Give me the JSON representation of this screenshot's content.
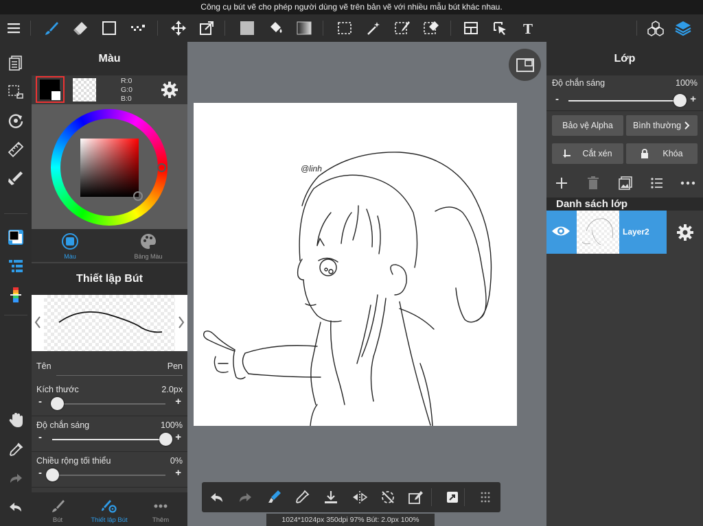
{
  "tooltip": "Công cụ bút vẽ cho phép người dùng vẽ trên bản vẽ với nhiều mẫu bút khác nhau.",
  "colors": {
    "accent": "#2f9ce8",
    "toolbar_bg": "#2d2d2d",
    "panel_bg": "#3a3a3a",
    "canvas_bg": "#6f7378",
    "layer_selected": "#3d9ae0",
    "primary_color": "#000000"
  },
  "toolbar": {
    "items": [
      "menu-icon",
      "brush-icon",
      "eraser-icon",
      "rectangle-icon",
      "dot-pen-icon",
      "move-icon",
      "transform-icon",
      "fill-color-icon",
      "bucket-icon",
      "gradient-icon",
      "select-rect-icon",
      "magic-wand-icon",
      "select-pen-icon",
      "select-eraser-icon",
      "layout-icon",
      "operation-icon",
      "text-icon",
      "materials-icon",
      "layers-icon"
    ]
  },
  "left_tools": [
    "layers-list-icon",
    "selection-icon",
    "rotate-icon",
    "ruler-icon",
    "pen-fill-icon",
    "color-swatch-icon",
    "layer-list-icon",
    "palette-strip-icon",
    "hand-icon",
    "eyedropper-icon",
    "redo-icon",
    "undo-icon"
  ],
  "color_panel": {
    "title": "Màu",
    "rgb": {
      "r": "R:0",
      "g": "G:0",
      "b": "B:0"
    },
    "tab_color": "Màu",
    "tab_palette": "Bảng Màu"
  },
  "pen_settings": {
    "title": "Thiết lập Bút",
    "name_label": "Tên",
    "name_value": "Pen",
    "size_label": "Kích thước",
    "size_value": "2.0px",
    "size_fraction": 0.04,
    "opacity_label": "Độ chắn sáng",
    "opacity_value": "100%",
    "opacity_fraction": 1.0,
    "min_width_label": "Chiều rộng tối thiểu",
    "min_width_value": "0%",
    "min_width_fraction": 0.0
  },
  "bottom_tabs": {
    "brush": "Bút",
    "settings": "Thiết lập Bút",
    "more": "Thêm"
  },
  "canvas": {
    "signature": "@linh",
    "status": "1024*1024px 350dpi 97% Bút: 2.0px 100%"
  },
  "bottom_tools": [
    "undo-icon",
    "redo-icon",
    "pen-eraser-icon",
    "eyedropper-icon",
    "save-icon",
    "flip-icon",
    "rotate-canvas-icon",
    "edit-icon",
    "share-icon",
    "grid-icon"
  ],
  "layer_panel": {
    "title": "Lớp",
    "opacity_label": "Độ chắn sáng",
    "opacity_value": "100%",
    "opacity_fraction": 1.0,
    "alpha_protect": "Bảo vệ Alpha",
    "blend_mode": "Bình thường",
    "clipping": "Cắt xén",
    "lock": "Khóa",
    "list_title": "Danh sách lớp",
    "layers": [
      {
        "name": "Layer2",
        "visible": true,
        "selected": true
      }
    ]
  }
}
